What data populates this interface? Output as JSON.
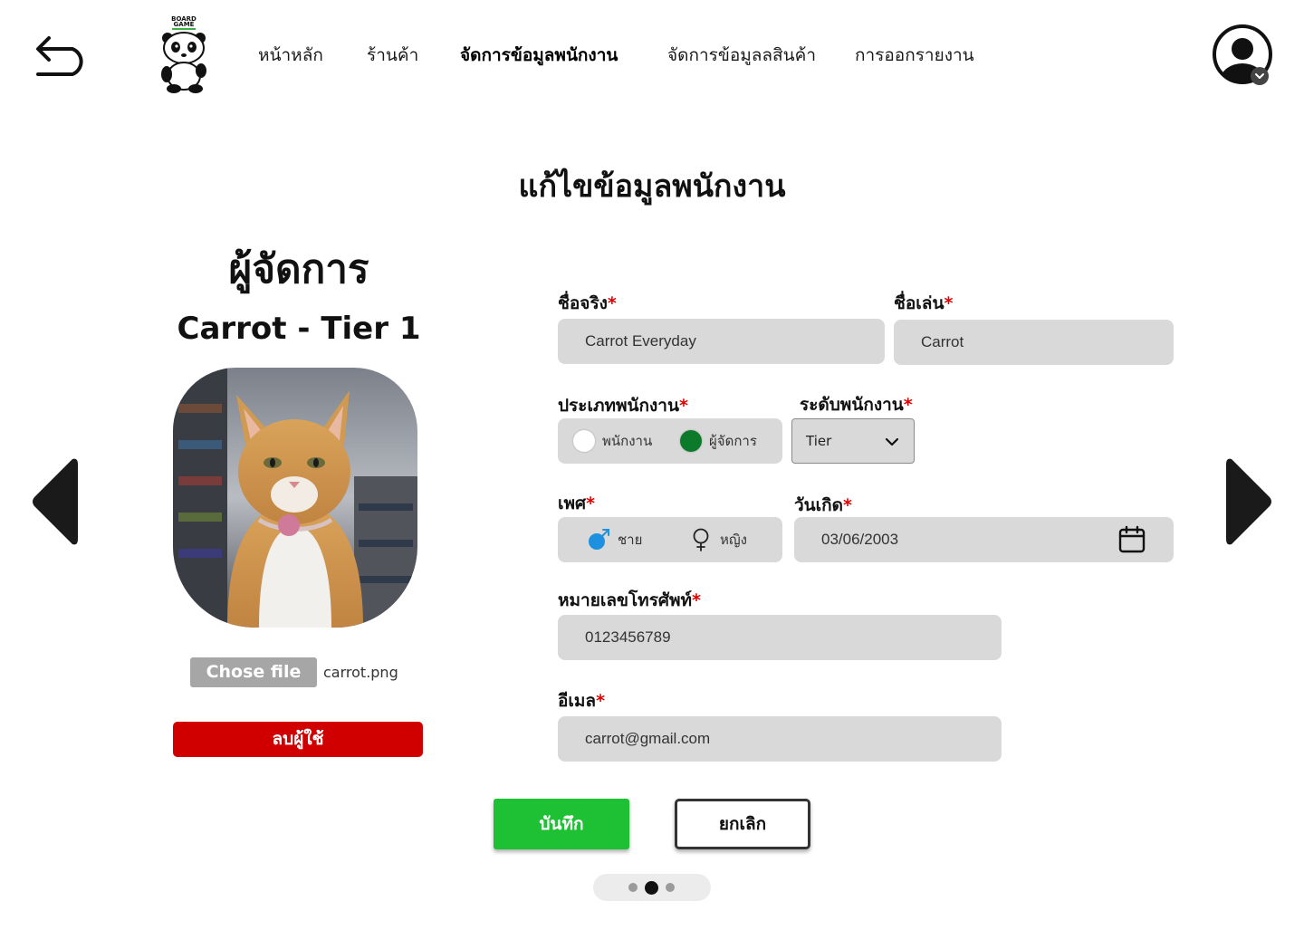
{
  "header": {
    "back_icon": "undo-arrow-icon",
    "logo_text_1": "BOARD",
    "logo_text_2": "GAME",
    "nav": [
      {
        "label": "หน้าหลัก",
        "active": false
      },
      {
        "label": "ร้านค้า",
        "active": false
      },
      {
        "label": "จัดการข้อมูลพนักงาน",
        "active": true
      },
      {
        "label": "จัดการข้อมูลลสินค้า",
        "active": false
      },
      {
        "label": "การออกรายงาน",
        "active": false
      }
    ],
    "avatar_icon": "user-circle-icon"
  },
  "page_title": "แก้ไขข้อมูลพนักงาน",
  "profile": {
    "role": "ผู้จัดการ",
    "name_tier": "Carrot - Tier 1",
    "file_button": "Chose file",
    "file_name": "carrot.png",
    "delete_button": "ลบผู้ใช้"
  },
  "form": {
    "real_name": {
      "label": "ชื่อจริง",
      "value": "Carrot Everyday"
    },
    "nickname": {
      "label": "ชื่อเล่น",
      "value": "Carrot"
    },
    "employee_type": {
      "label": "ประเภทพนักงาน",
      "options": [
        "พนักงาน",
        "ผู้จัดการ"
      ],
      "selected": "ผู้จัดการ"
    },
    "employee_level": {
      "label": "ระดับพนักงาน",
      "value": "Tier"
    },
    "gender": {
      "label": "เพศ",
      "options": [
        "ชาย",
        "หญิง"
      ]
    },
    "birthdate": {
      "label": "วันเกิด",
      "value": "03/06/2003"
    },
    "phone": {
      "label": "หมายเลขโทรศัพท์",
      "value": "0123456789"
    },
    "email": {
      "label": "อีเมล",
      "value": "carrot@gmail.com"
    },
    "required_mark": "*"
  },
  "actions": {
    "save": "บันทึก",
    "cancel": "ยกเลิก"
  },
  "pager": {
    "count": 3,
    "active": 2
  },
  "colors": {
    "save": "#1ec133",
    "delete": "#d10000",
    "required": "#e00000",
    "field_bg": "#d9d9d9",
    "radio_selected": "#0b7a2a",
    "male_icon": "#1e90e0"
  }
}
